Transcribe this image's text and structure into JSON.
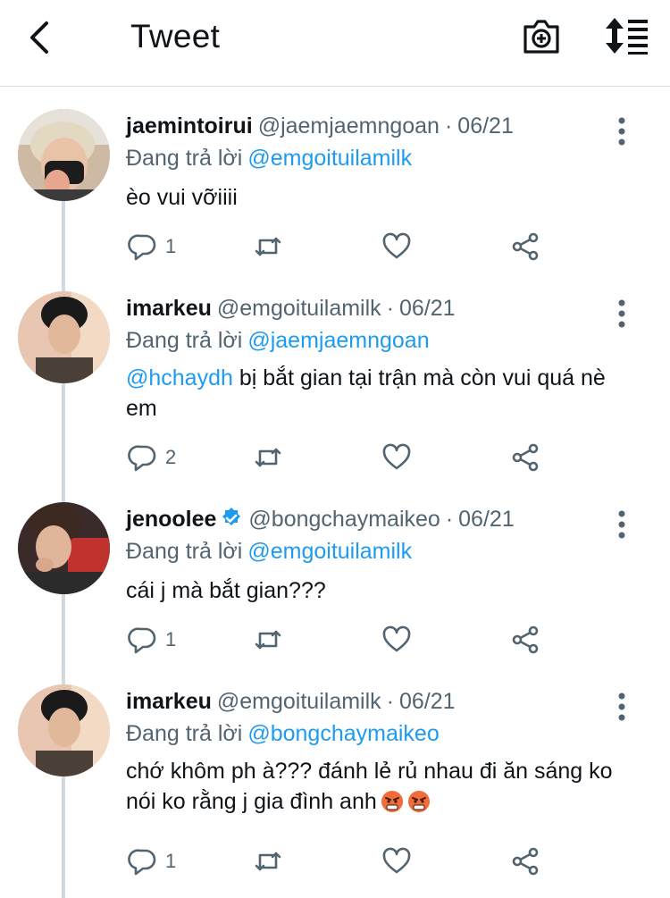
{
  "header": {
    "title": "Tweet"
  },
  "colors": {
    "link": "#1d9bf0",
    "secondary": "#536471",
    "verified": "#1d9bf0"
  },
  "tweets": [
    {
      "name": "jaemintoirui",
      "handle": "@jaemjaemngoan",
      "date": "06/21",
      "reply_prefix": "Đang trả lời",
      "reply_to": "@emgoituilamilk",
      "text": "èo vui vỡiiii",
      "replies": "1",
      "verified": false
    },
    {
      "name": "imarkeu",
      "handle": "@emgoituilamilk",
      "date": "06/21",
      "reply_prefix": "Đang trả lời",
      "reply_to": "@jaemjaemngoan",
      "text_mention": "@hchaydh",
      "text": " bị bắt gian tại trận mà còn vui quá nè em",
      "replies": "2",
      "verified": false
    },
    {
      "name": "jenoolee",
      "handle": "@bongchaymaikeo",
      "date": "06/21",
      "reply_prefix": "Đang trả lời",
      "reply_to": "@emgoituilamilk",
      "text": "cái j mà bắt gian???",
      "replies": "1",
      "verified": true
    },
    {
      "name": "imarkeu",
      "handle": "@emgoituilamilk",
      "date": "06/21",
      "reply_prefix": "Đang trả lời",
      "reply_to": "@bongchaymaikeo",
      "text": "chớ khôm ph à??? đánh lẻ rủ nhau đi ăn sáng ko nói ko rằng j gia đình anh",
      "emojis": [
        "angry-face-emoji",
        "angry-face-emoji"
      ],
      "replies": "1",
      "verified": false
    }
  ],
  "dot_separator": "·"
}
